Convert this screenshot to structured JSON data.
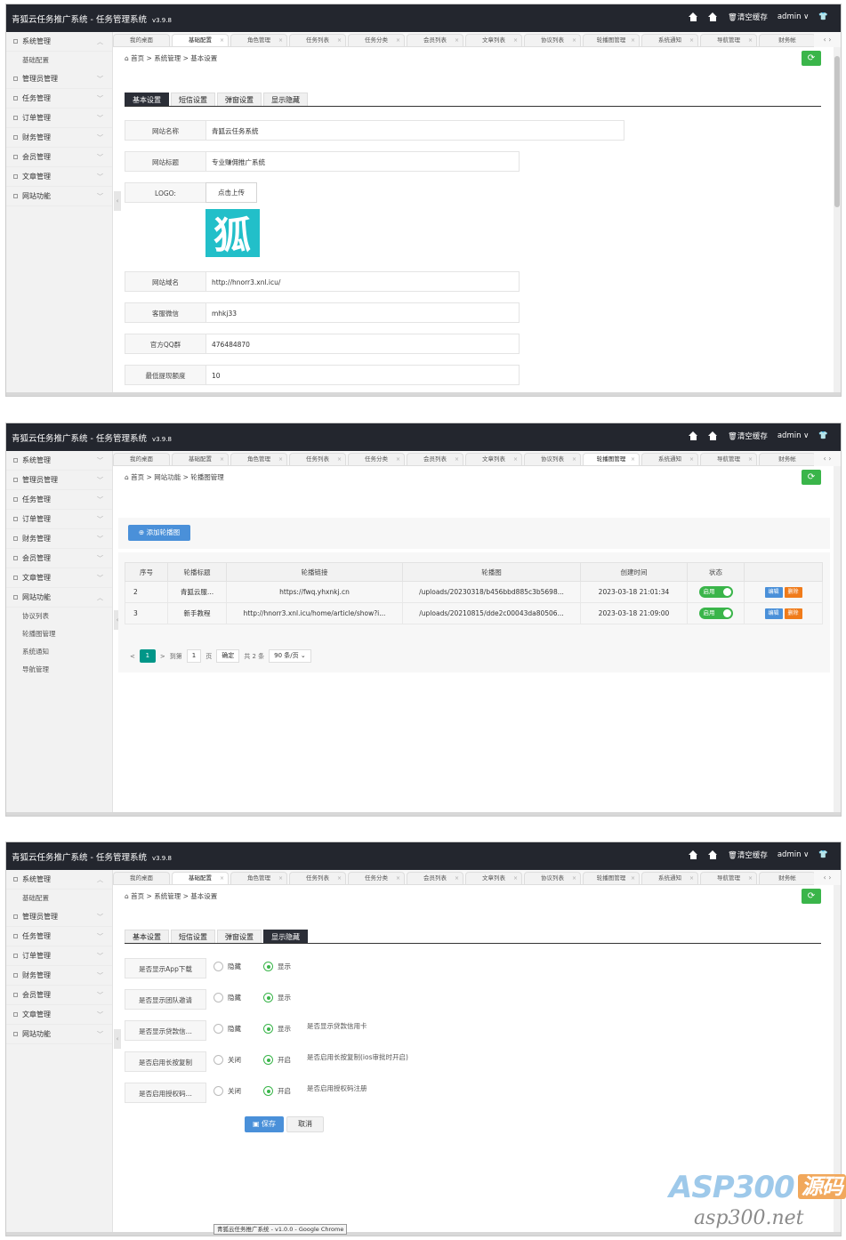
{
  "app": {
    "title": "青狐云任务推广系统 - 任务管理系统",
    "version": "v3.9.8",
    "clear_cache": "清空缓存",
    "user": "admin ∨",
    "accent_green": "#3ab54a",
    "dark_bar": "#23262e"
  },
  "tabs": [
    "我的桌面",
    "基础配置",
    "角色管理",
    "任务列表",
    "任务分类",
    "会员列表",
    "文章列表",
    "协议列表",
    "轮播图管理",
    "系统通知",
    "导航管理",
    "财务帐"
  ],
  "sidebar": {
    "system": "系统管理",
    "basic_config": "基础配置",
    "admin": "管理员管理",
    "task": "任务管理",
    "order": "订单管理",
    "finance": "财务管理",
    "member": "会员管理",
    "article": "文章管理",
    "site": "网站功能",
    "site_sub": [
      "协议列表",
      "轮播图管理",
      "系统通知",
      "导航管理"
    ]
  },
  "breadcrumb": {
    "home": "首页",
    "sep": ">",
    "system": "系统管理",
    "basic": "基本设置",
    "site": "网站功能",
    "banner": "轮播图管理"
  },
  "subtabs": [
    "基本设置",
    "短信设置",
    "弹窗设置",
    "显示隐藏"
  ],
  "basic_form": {
    "site_name_label": "网站名称",
    "site_name": "青狐云任务系统",
    "site_title_label": "网站标题",
    "site_title": "专业赚佣推广系统",
    "logo_label": "LOGO:",
    "upload": "点击上传",
    "logo_char": "狐",
    "domain_label": "网站域名",
    "domain": "http://hnorr3.xnl.icu/",
    "wechat_label": "客服微信",
    "wechat": "mhkj33",
    "qq_label": "官方QQ群",
    "qq": "476484870",
    "min_withdraw_label": "最低提现额度",
    "min_withdraw": "10"
  },
  "banner": {
    "add_button": "添加轮播图",
    "columns": [
      "序号",
      "轮播标题",
      "轮播链接",
      "轮播图",
      "创建时间",
      "状态",
      ""
    ],
    "rows": [
      {
        "id": "2",
        "title": "青狐云服...",
        "link": "https://fwq.yhxnkj.cn",
        "image": "/uploads/20230318/b456bbd885c3b5698...",
        "created": "2023-03-18 21:01:34",
        "status": "启用"
      },
      {
        "id": "3",
        "title": "新手教程",
        "link": "http://hnorr3.xnl.icu/home/article/show?i...",
        "image": "/uploads/20210815/dde2c00043da80506...",
        "created": "2023-03-18 21:09:00",
        "status": "启用"
      }
    ],
    "edit": "编辑",
    "delete": "删除",
    "pager": {
      "prev": "<",
      "page": "1",
      "next": ">",
      "goto": "到第",
      "page_input": "1",
      "page_unit": "页",
      "confirm": "确定",
      "total": "共 2 条",
      "per_page": "90 条/页"
    }
  },
  "visibility_form": {
    "rows": [
      {
        "label": "是否显示App下载",
        "opt1": "隐藏",
        "opt2": "显示",
        "hint": ""
      },
      {
        "label": "是否显示团队邀请",
        "opt1": "隐藏",
        "opt2": "显示",
        "hint": ""
      },
      {
        "label": "是否显示贷款信...",
        "opt1": "隐藏",
        "opt2": "显示",
        "hint": "是否显示贷款信用卡"
      },
      {
        "label": "是否启用长按复制",
        "opt1": "关闭",
        "opt2": "开启",
        "hint": "是否启用长按复制(ios审批时开启)"
      },
      {
        "label": "是否启用授权码...",
        "opt1": "关闭",
        "opt2": "开启",
        "hint": "是否启用授权码注册"
      }
    ],
    "save": "保存",
    "cancel": "取消"
  },
  "watermark": {
    "brand": "ASP300",
    "brand_tag": "源码",
    "url": "asp300.net"
  },
  "tooltip": "青狐云任务推广系统 - v1.0.0 - Google Chrome"
}
